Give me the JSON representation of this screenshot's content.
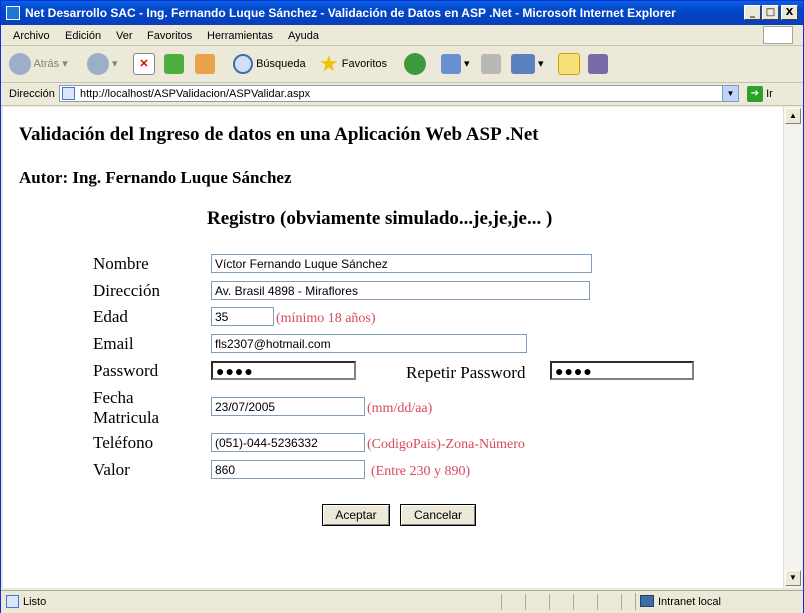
{
  "window": {
    "title": "Net Desarrollo SAC - Ing. Fernando Luque Sánchez - Validación de Datos en ASP .Net - Microsoft Internet Explorer",
    "min": "_",
    "max": "□",
    "close": "X"
  },
  "menu": [
    "Archivo",
    "Edición",
    "Ver",
    "Favoritos",
    "Herramientas",
    "Ayuda"
  ],
  "toolbar": {
    "back": "Atrás",
    "search": "Búsqueda",
    "favorites": "Favoritos"
  },
  "address": {
    "label": "Dirección",
    "url": "http://localhost/ASPValidacion/ASPValidar.aspx",
    "go": "Ir"
  },
  "page": {
    "title": "Validación del Ingreso de datos en una Aplicación Web ASP .Net",
    "author": "Autor: Ing. Fernando Luque Sánchez",
    "form_title": "Registro (obviamente simulado...je,je,je... )"
  },
  "form": {
    "nombre_label": "Nombre",
    "nombre_value": "Víctor Fernando Luque Sánchez",
    "direccion_label": "Dirección",
    "direccion_value": "Av. Brasil 4898 - Miraflores",
    "edad_label": "Edad",
    "edad_value": "35",
    "edad_hint": "(mínimo 18 años)",
    "email_label": "Email",
    "email_value": "fls2307@hotmail.com",
    "password_label": "Password",
    "password_value": "●●●●",
    "repetir_label": "Repetir Password",
    "repetir_value": "●●●●",
    "fecha_label_1": "Fecha",
    "fecha_label_2": "Matricula",
    "fecha_value": "23/07/2005",
    "fecha_hint": "(mm/dd/aa)",
    "telefono_label": "Teléfono",
    "telefono_value": "(051)-044-5236332",
    "telefono_hint": "(CodigoPais)-Zona-Número",
    "valor_label": "Valor",
    "valor_value": "860",
    "valor_hint": "(Entre 230 y 890)",
    "aceptar": "Aceptar",
    "cancelar": "Cancelar"
  },
  "status": {
    "text": "Listo",
    "zone": "Intranet local"
  }
}
